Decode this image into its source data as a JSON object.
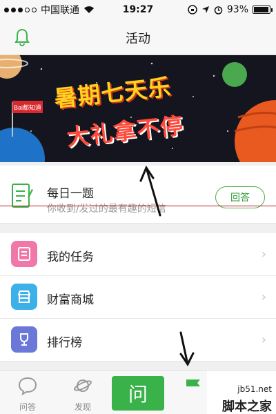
{
  "status_bar": {
    "carrier": "中国联通",
    "time": "19:27",
    "battery": "93%"
  },
  "nav": {
    "title": "活动"
  },
  "banner": {
    "line1": "暑期七天乐",
    "line2": "大礼拿不停",
    "badge": "Bai都知道"
  },
  "question_card": {
    "title": "每日一题",
    "subtitle": "你收到/发过的最有趣的短信",
    "answer_label": "回答"
  },
  "menu": [
    {
      "label": "我的任务",
      "icon": "task-icon",
      "color": "#f078a8"
    },
    {
      "label": "财富商城",
      "icon": "store-icon",
      "color": "#3cb0e8"
    },
    {
      "label": "排行榜",
      "icon": "trophy-icon",
      "color": "#6b78d8"
    }
  ],
  "tabs": {
    "qa_label": "问答",
    "discover_label": "发现",
    "center_label": "问"
  },
  "watermark": {
    "site": "jb51.net",
    "name": "脚本之家"
  },
  "colors": {
    "accent": "#3ab24a",
    "background": "#f0f0f0"
  }
}
